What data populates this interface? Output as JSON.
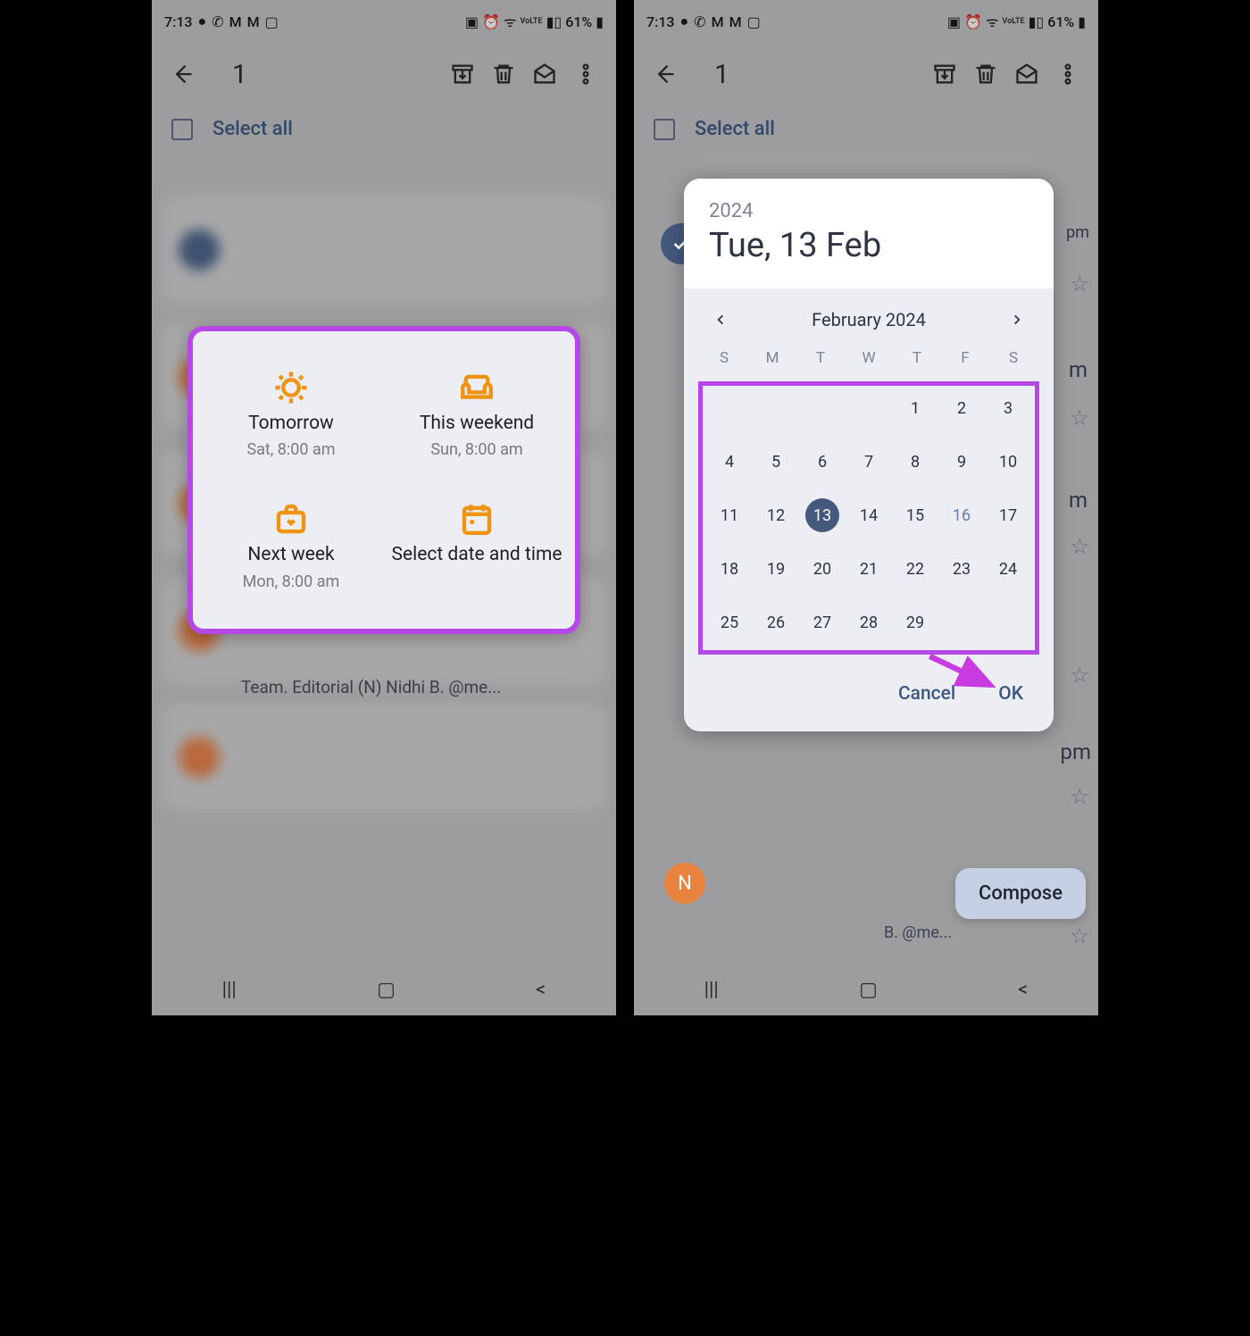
{
  "status": {
    "time": "7:13",
    "battery": "61%"
  },
  "toolbar": {
    "count": "1"
  },
  "select_all": "Select all",
  "snooze": {
    "tomorrow": {
      "title": "Tomorrow",
      "sub": "Sat, 8:00 am"
    },
    "weekend": {
      "title": "This weekend",
      "sub": "Sun, 8:00 am"
    },
    "nextweek": {
      "title": "Next week",
      "sub": "Mon, 8:00 am"
    },
    "custom": {
      "title": "Select date and time"
    }
  },
  "partial_text": "Team. Editorial (N) Nidhi B. @me...",
  "picker": {
    "year": "2024",
    "date_label": "Tue, 13 Feb",
    "month_label": "February 2024",
    "dow": [
      "S",
      "M",
      "T",
      "W",
      "T",
      "F",
      "S"
    ],
    "leading_blanks": 4,
    "days": 29,
    "selected": 13,
    "today": 16,
    "cancel": "Cancel",
    "ok": "OK"
  },
  "right_extras": {
    "pm": "pm",
    "m1": "m",
    "m2": "m",
    "pm2": "pm",
    "avatar_n": "N",
    "compose": "Compose",
    "fragment": "B. @me..."
  }
}
